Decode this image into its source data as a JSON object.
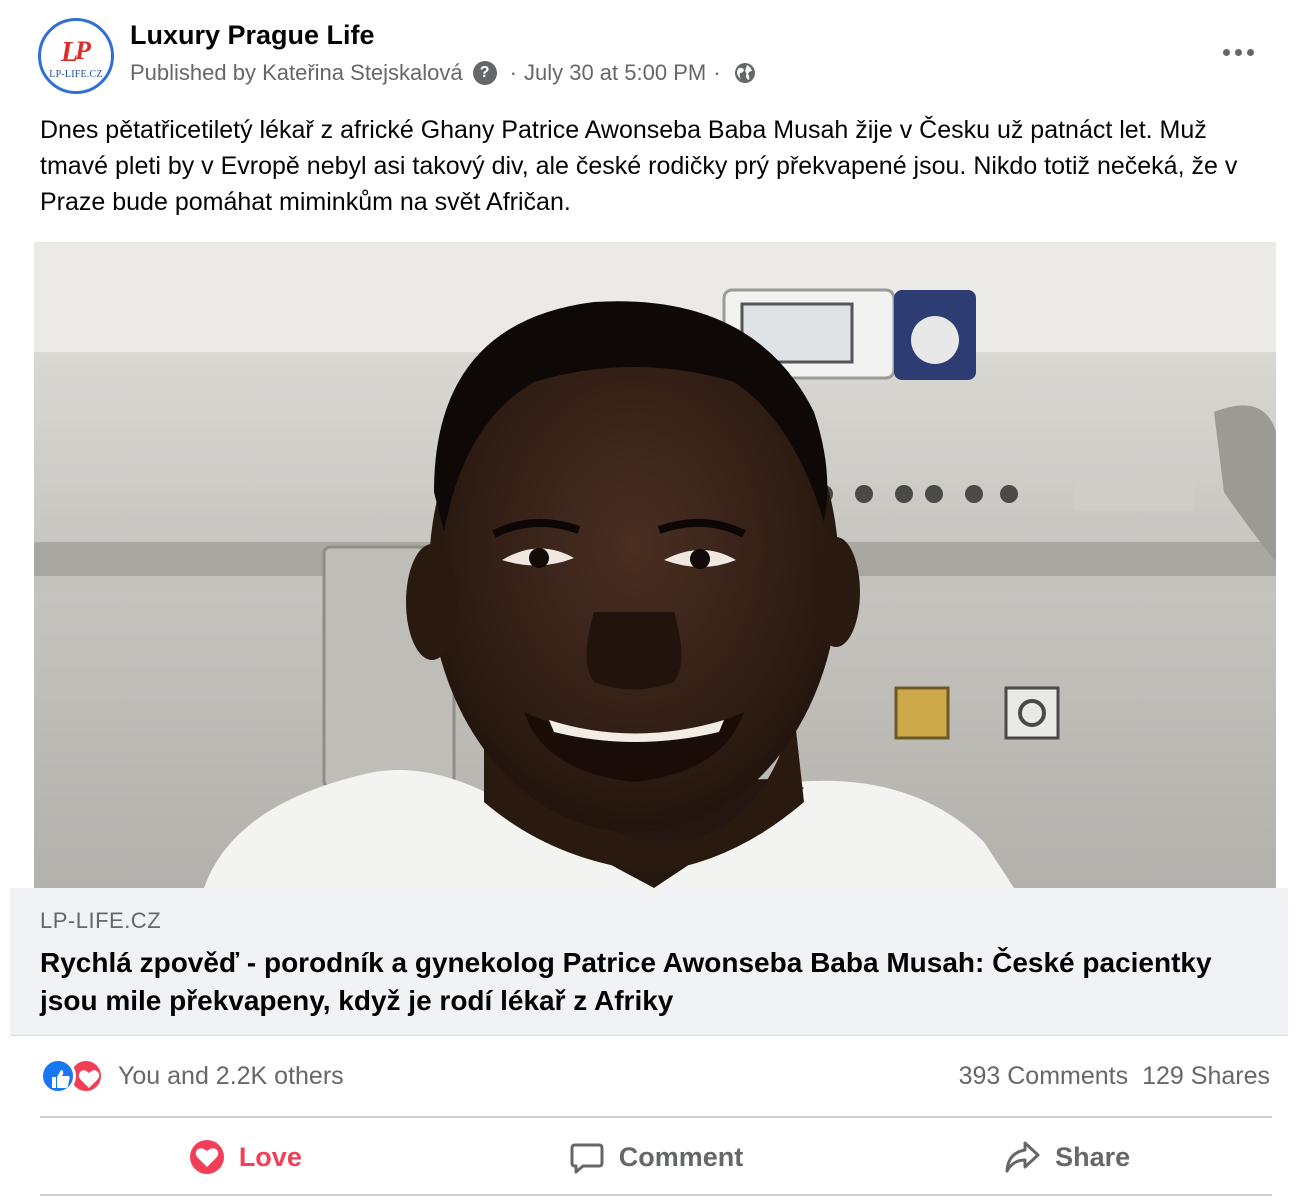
{
  "post": {
    "page_name": "Luxury Prague Life",
    "avatar_text": "LP-LIFE.CZ",
    "published_by": "Published by Kateřina Stejskalová",
    "help_glyph": "?",
    "separator": "·",
    "timestamp": "July 30 at 5:00 PM",
    "audience_icon": "globe-icon",
    "text": "Dnes pětatřicetiletý lékař z africké Ghany Patrice Awonseba Baba Musah žije v Česku už patnáct let. Muž tmavé pleti by v Evropě nebyl asi takový div, ale české rodičky prý překvapené jsou. Nikdo totiž nečeká, že v Praze bude pomáhat miminkům na svět Afričan."
  },
  "link_preview": {
    "domain": "LP-LIFE.CZ",
    "title": "Rychlá zpověď - porodník a gynekolog Patrice Awonseba Baba Musah: České pacientky jsou mile překvapeny, když je rodí lékař z Afriky"
  },
  "engagement": {
    "reactions_text": "You and 2.2K others",
    "comments": "393 Comments",
    "shares": "129 Shares"
  },
  "actions": {
    "love": "Love",
    "comment": "Comment",
    "share": "Share"
  },
  "colors": {
    "facebook_blue": "#1877f2",
    "love_red": "#f33e58",
    "secondary_text": "#65676b",
    "preview_bg": "#f0f2f5"
  }
}
